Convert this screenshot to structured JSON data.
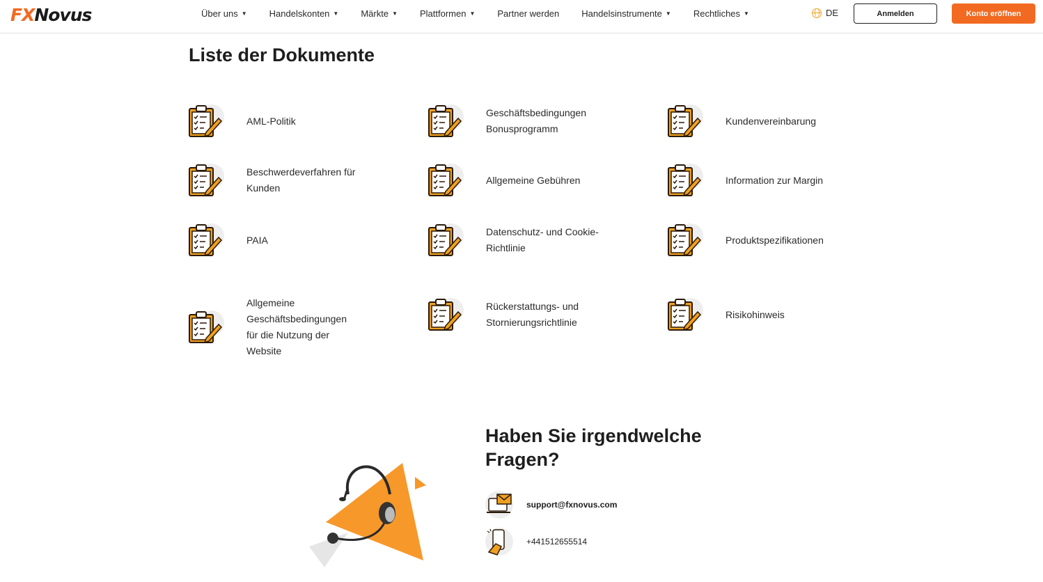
{
  "header": {
    "logo": {
      "fx": "FX",
      "novus": "Novus"
    },
    "nav": [
      {
        "label": "Über uns",
        "dropdown": true
      },
      {
        "label": "Handelskonten",
        "dropdown": true
      },
      {
        "label": "Märkte",
        "dropdown": true
      },
      {
        "label": "Plattformen",
        "dropdown": true
      },
      {
        "label": "Partner werden",
        "dropdown": false
      },
      {
        "label": "Handelsinstrumente",
        "dropdown": true
      },
      {
        "label": "Rechtliches",
        "dropdown": true
      }
    ],
    "language": "DE",
    "login_label": "Anmelden",
    "open_account_label": "Konto eröffnen"
  },
  "documents": {
    "title": "Liste der Dokumente",
    "items": [
      {
        "label": "AML-Politik"
      },
      {
        "label": "Geschäftsbedingungen Bonusprogramm"
      },
      {
        "label": "Kundenvereinbarung"
      },
      {
        "label": "Beschwerdeverfahren für Kunden"
      },
      {
        "label": "Allgemeine Gebühren"
      },
      {
        "label": "Information zur Margin"
      },
      {
        "label": "PAIA"
      },
      {
        "label": "Datenschutz- und Cookie-Richtlinie"
      },
      {
        "label": "Produktspezifikationen"
      },
      {
        "label": "Allgemeine Geschäftsbedingungen für die Nutzung der Website"
      },
      {
        "label": "Rückerstattungs- und Stornierungsrichtlinie"
      },
      {
        "label": "Risikohinweis"
      }
    ]
  },
  "contact": {
    "title": "Haben Sie irgendwelche Fragen?",
    "email": "support@fxnovus.com",
    "phone": "+441512655514"
  },
  "colors": {
    "brand_orange": "#f26a21",
    "icon_orange": "#f0a020"
  }
}
